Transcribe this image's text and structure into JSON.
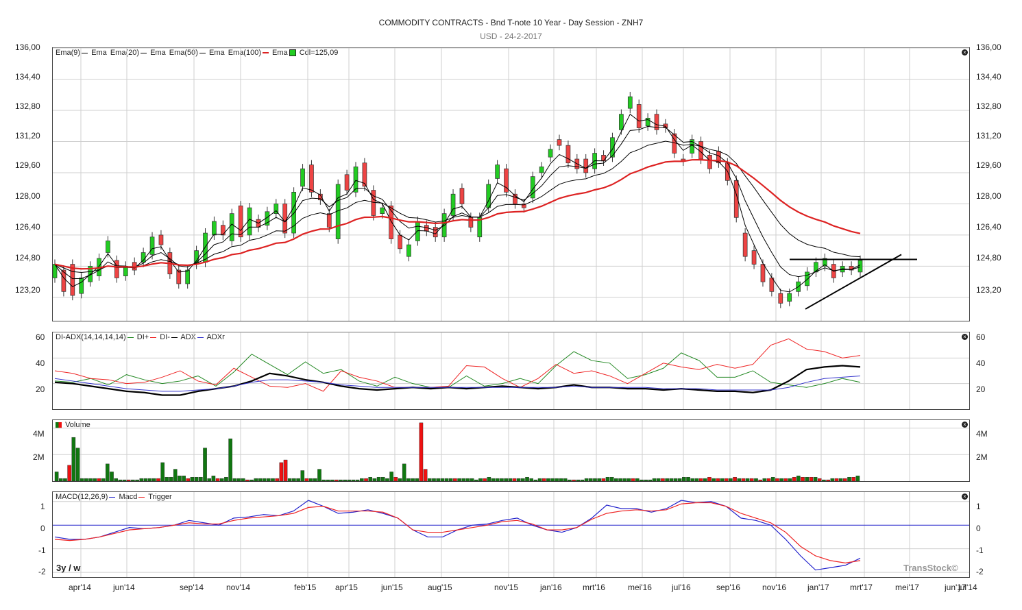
{
  "header": {
    "title": "COMMODITY CONTRACTS - Bnd T-note 10 Year - Day Session - ZNH7",
    "subtitle": "USD - 24-2-2017"
  },
  "panels": {
    "price": {
      "legend": [
        "Ema(9)",
        "Ema",
        "Ema(20)",
        "Ema",
        "Ema(50)",
        "Ema",
        "Ema(100)",
        "Ema",
        "Cdl=125,09"
      ],
      "y_ticks": [
        "136,00",
        "134,40",
        "132,80",
        "131,20",
        "129,60",
        "128,00",
        "126,40",
        "124,80",
        "123,20"
      ]
    },
    "adx": {
      "legend": [
        "DI-ADX(14,14,14,14)",
        "DI+",
        "DI-",
        "ADX",
        "ADXr"
      ],
      "y_ticks": [
        "60",
        "40",
        "20"
      ]
    },
    "volume": {
      "legend": [
        "Volume"
      ],
      "y_ticks": [
        "4M",
        "2M"
      ]
    },
    "macd": {
      "legend": [
        "MACD(12,26,9)",
        "Macd",
        "Trigger"
      ],
      "y_ticks": [
        "1",
        "0",
        "-1",
        "-2"
      ]
    }
  },
  "x_ticks": [
    "apr'14",
    "jun'14",
    "sep'14",
    "nov'14",
    "feb'15",
    "apr'15",
    "jun'15",
    "aug'15",
    "nov'15",
    "jan'16",
    "mrt'16",
    "mei'16",
    "jul'16",
    "sep'16",
    "nov'16",
    "jan'17",
    "mrt'17",
    "mei'17",
    "jun'17",
    "jul'14"
  ],
  "footer": {
    "timeframe": "3y / w",
    "brand": "TransStock©"
  },
  "colors": {
    "up": "#22cc22",
    "down": "#ee4444",
    "ema100": "#dd2222",
    "ema": "#000000",
    "di_plus": "#228822",
    "di_minus": "#ee2222",
    "adx": "#000000",
    "adxr": "#3333cc",
    "macd": "#2222cc",
    "trigger": "#ee2222",
    "vol_up": "#117711",
    "vol_down": "#ee1111"
  },
  "chart_data": [
    {
      "type": "candlestick",
      "title": "COMMODITY CONTRACTS - Bnd T-note 10 Year - Day Session - ZNH7",
      "ylim": [
        122,
        136
      ],
      "x_range": [
        "2014-03-31",
        "2017-07-31"
      ],
      "candles": [
        [
          124.2,
          124.9
        ],
        [
          124.6,
          123.5
        ],
        [
          124.9,
          123.3
        ],
        [
          123.4,
          124.2
        ],
        [
          124.0,
          124.8
        ],
        [
          124.3,
          125.2
        ],
        [
          125.5,
          126.1
        ],
        [
          125.1,
          124.2
        ],
        [
          124.3,
          124.8
        ],
        [
          125.0,
          124.6
        ],
        [
          125.0,
          125.5
        ],
        [
          125.4,
          126.3
        ],
        [
          126.4,
          125.9
        ],
        [
          125.5,
          124.4
        ],
        [
          124.6,
          123.9
        ],
        [
          123.9,
          124.6
        ],
        [
          124.9,
          125.6
        ],
        [
          125.0,
          126.5
        ],
        [
          126.4,
          127.1
        ],
        [
          126.9,
          126.4
        ],
        [
          126.1,
          127.5
        ],
        [
          127.9,
          126.3
        ],
        [
          126.4,
          127.8
        ],
        [
          127.2,
          126.8
        ],
        [
          126.9,
          127.6
        ],
        [
          127.5,
          128.0
        ],
        [
          128.0,
          126.5
        ],
        [
          126.5,
          128.6
        ],
        [
          128.9,
          129.8
        ],
        [
          130.0,
          128.6
        ],
        [
          128.5,
          128.2
        ],
        [
          127.5,
          126.8
        ],
        [
          126.2,
          129.0
        ],
        [
          129.5,
          128.7
        ],
        [
          128.6,
          129.9
        ],
        [
          130.1,
          128.9
        ],
        [
          128.7,
          127.4
        ],
        [
          127.5,
          127.8
        ],
        [
          127.9,
          126.2
        ],
        [
          126.4,
          125.7
        ],
        [
          125.3,
          125.9
        ],
        [
          126.1,
          127.1
        ],
        [
          126.9,
          126.6
        ],
        [
          126.8,
          126.3
        ],
        [
          126.3,
          127.5
        ],
        [
          127.4,
          128.5
        ],
        [
          128.8,
          128.0
        ],
        [
          127.3,
          126.8
        ],
        [
          126.3,
          127.3
        ],
        [
          127.8,
          129.0
        ],
        [
          129.3,
          130.0
        ],
        [
          129.8,
          128.6
        ],
        [
          128.5,
          128.0
        ],
        [
          128.0,
          127.8
        ],
        [
          128.3,
          129.4
        ],
        [
          129.6,
          129.9
        ],
        [
          130.4,
          130.8
        ],
        [
          131.3,
          131.0
        ],
        [
          131.0,
          130.1
        ],
        [
          130.3,
          129.8
        ],
        [
          130.3,
          129.6
        ],
        [
          129.8,
          130.6
        ],
        [
          130.5,
          130.2
        ],
        [
          130.4,
          131.4
        ],
        [
          131.8,
          132.6
        ],
        [
          132.9,
          133.5
        ],
        [
          133.1,
          131.9
        ],
        [
          132.0,
          132.4
        ],
        [
          132.6,
          131.8
        ],
        [
          132.1,
          131.9
        ],
        [
          131.6,
          130.6
        ],
        [
          130.3,
          130.2
        ],
        [
          130.6,
          131.3
        ],
        [
          131.2,
          130.3
        ],
        [
          130.5,
          129.8
        ],
        [
          130.7,
          130.1
        ],
        [
          130.1,
          129.2
        ],
        [
          129.2,
          127.3
        ],
        [
          126.5,
          125.3
        ],
        [
          125.6,
          124.9
        ],
        [
          124.9,
          124.0
        ],
        [
          124.2,
          123.5
        ],
        [
          123.4,
          122.9
        ],
        [
          123.0,
          123.4
        ],
        [
          123.5,
          124.0
        ],
        [
          123.8,
          124.5
        ],
        [
          124.5,
          125.0
        ],
        [
          124.8,
          125.2
        ],
        [
          124.9,
          124.2
        ],
        [
          124.5,
          124.8
        ],
        [
          124.8,
          124.6
        ],
        [
          124.5,
          125.1
        ]
      ]
    },
    {
      "type": "line",
      "title": "DI-ADX(14,14,14,14)",
      "ylim": [
        0,
        60
      ],
      "series": [
        {
          "name": "DI+",
          "values": [
            22,
            21,
            24,
            19,
            27,
            23,
            20,
            22,
            26,
            18,
            29,
            43,
            35,
            27,
            37,
            28,
            31,
            22,
            18,
            25,
            20,
            17,
            17,
            26,
            18,
            20,
            24,
            20,
            34,
            45,
            38,
            36,
            24,
            27,
            32,
            44,
            38,
            25,
            25,
            30,
            21,
            19,
            17,
            20,
            24,
            21
          ]
        },
        {
          "name": "DI-",
          "values": [
            30,
            28,
            24,
            23,
            20,
            21,
            25,
            30,
            22,
            19,
            32,
            25,
            18,
            17,
            20,
            14,
            30,
            25,
            22,
            17,
            17,
            17,
            18,
            34,
            33,
            24,
            17,
            24,
            35,
            28,
            30,
            26,
            20,
            28,
            36,
            33,
            31,
            35,
            32,
            35,
            50,
            55,
            47,
            45,
            40,
            42
          ]
        },
        {
          "name": "ADX",
          "values": [
            21,
            20,
            18,
            16,
            14,
            13,
            11,
            11,
            14,
            16,
            18,
            22,
            28,
            26,
            23,
            21,
            18,
            16,
            15,
            16,
            17,
            16,
            17,
            16,
            17,
            18,
            17,
            16,
            17,
            19,
            17,
            17,
            16,
            16,
            15,
            16,
            15,
            14,
            14,
            13,
            15,
            22,
            31,
            33,
            34,
            33
          ]
        },
        {
          "name": "ADXr",
          "values": [
            24,
            22,
            20,
            18,
            16,
            15,
            14,
            14,
            15,
            16,
            18,
            21,
            23,
            23,
            22,
            21,
            19,
            18,
            17,
            17,
            17,
            17,
            17,
            17,
            17,
            17,
            17,
            17,
            17,
            18,
            17,
            17,
            17,
            17,
            16,
            16,
            16,
            15,
            15,
            15,
            15,
            17,
            21,
            24,
            25,
            26
          ]
        }
      ]
    },
    {
      "type": "bar",
      "title": "Volume",
      "ylim": [
        0,
        4600000
      ],
      "values": [
        0.7,
        0.2,
        0.2,
        1.2,
        3.3,
        2.5,
        0.2,
        0.2,
        0.2,
        0.2,
        0.2,
        0.2,
        1.3,
        0.7,
        0.2,
        0.1,
        0.1,
        0.1,
        0.1,
        0.1,
        0.2,
        0.2,
        0.2,
        0.2,
        0.2,
        1.4,
        0.3,
        0.3,
        0.9,
        0.4,
        0.4,
        0.2,
        0.3,
        0.3,
        0.3,
        2.5,
        0.2,
        0.4,
        0.2,
        0.2,
        0.3,
        3.2,
        0.2,
        0.2,
        0.2,
        0.1,
        0.1,
        0.2,
        0.2,
        0.2,
        0.2,
        0.2,
        0.2,
        1.4,
        1.6,
        0.2,
        0.2,
        0.2,
        0.8,
        0.2,
        0.2,
        0.2,
        0.9,
        0.1,
        0.1,
        0.1,
        0.1,
        0.1,
        0.1,
        0.1,
        0.1,
        0.1,
        0.2,
        0.2,
        0.3,
        0.2,
        0.3,
        0.3,
        0.2,
        0.7,
        0.3,
        0.2,
        1.3,
        0.2,
        0.2,
        0.2,
        4.4,
        0.9,
        0.2,
        0.2,
        0.2,
        0.2,
        0.2,
        0.2,
        0.2,
        0.2,
        0.2,
        0.2,
        0.2,
        0.1,
        0.2,
        0.2,
        0.3,
        0.2,
        0.2,
        0.2,
        0.2,
        0.2,
        0.2,
        0.2,
        0.2,
        0.3,
        0.2,
        0.1,
        0.2,
        0.2,
        0.2,
        0.2,
        0.2,
        0.2,
        0.2,
        0.1,
        0.1,
        0.1,
        0.1,
        0.2,
        0.2,
        0.2,
        0.2,
        0.2,
        0.3,
        0.3,
        0.2,
        0.2,
        0.2,
        0.2,
        0.2,
        0.2,
        0.1,
        0.1,
        0.1,
        0.2,
        0.2,
        0.2,
        0.2,
        0.2,
        0.2,
        0.2,
        0.3,
        0.3,
        0.2,
        0.2,
        0.2,
        0.2,
        0.3,
        0.2,
        0.2,
        0.2,
        0.2,
        0.2,
        0.3,
        0.2,
        0.2,
        0.2,
        0.2,
        0.2,
        0.1,
        0.2,
        0.2,
        0.3,
        0.2,
        0.2,
        0.2,
        0.2,
        0.3,
        0.4,
        0.3,
        0.3,
        0.3,
        0.3,
        0.2,
        0.1,
        0.1,
        0.2,
        0.2,
        0.2,
        0.2,
        0.3,
        0.3,
        0.4
      ]
    },
    {
      "type": "line",
      "title": "MACD(12,26,9)",
      "ylim": [
        -2.2,
        1.4
      ],
      "series": [
        {
          "name": "Macd",
          "values": [
            -0.5,
            -0.6,
            -0.6,
            -0.5,
            -0.3,
            -0.1,
            -0.15,
            -0.1,
            0.0,
            0.2,
            0.1,
            0.0,
            0.3,
            0.35,
            0.45,
            0.4,
            0.6,
            1.05,
            0.8,
            0.5,
            0.55,
            0.65,
            0.5,
            0.3,
            -0.2,
            -0.5,
            -0.5,
            -0.2,
            0.0,
            0.05,
            0.2,
            0.3,
            0.0,
            -0.2,
            -0.3,
            -0.1,
            0.3,
            0.85,
            0.7,
            0.7,
            0.55,
            0.7,
            1.05,
            0.95,
            1.0,
            0.8,
            0.3,
            0.2,
            0.0,
            -0.6,
            -1.3,
            -1.9,
            -1.8,
            -1.7,
            -1.4
          ]
        },
        {
          "name": "Trigger",
          "values": [
            -0.6,
            -0.65,
            -0.6,
            -0.5,
            -0.35,
            -0.2,
            -0.15,
            -0.1,
            0.0,
            0.1,
            0.05,
            0.05,
            0.2,
            0.3,
            0.35,
            0.4,
            0.5,
            0.75,
            0.8,
            0.6,
            0.6,
            0.6,
            0.55,
            0.3,
            -0.2,
            -0.3,
            -0.3,
            -0.2,
            -0.1,
            0.0,
            0.15,
            0.2,
            0.05,
            -0.2,
            -0.2,
            -0.1,
            0.25,
            0.5,
            0.6,
            0.65,
            0.6,
            0.65,
            0.9,
            0.95,
            0.95,
            0.8,
            0.5,
            0.3,
            0.1,
            -0.3,
            -0.9,
            -1.3,
            -1.5,
            -1.6,
            -1.5
          ]
        }
      ]
    }
  ]
}
